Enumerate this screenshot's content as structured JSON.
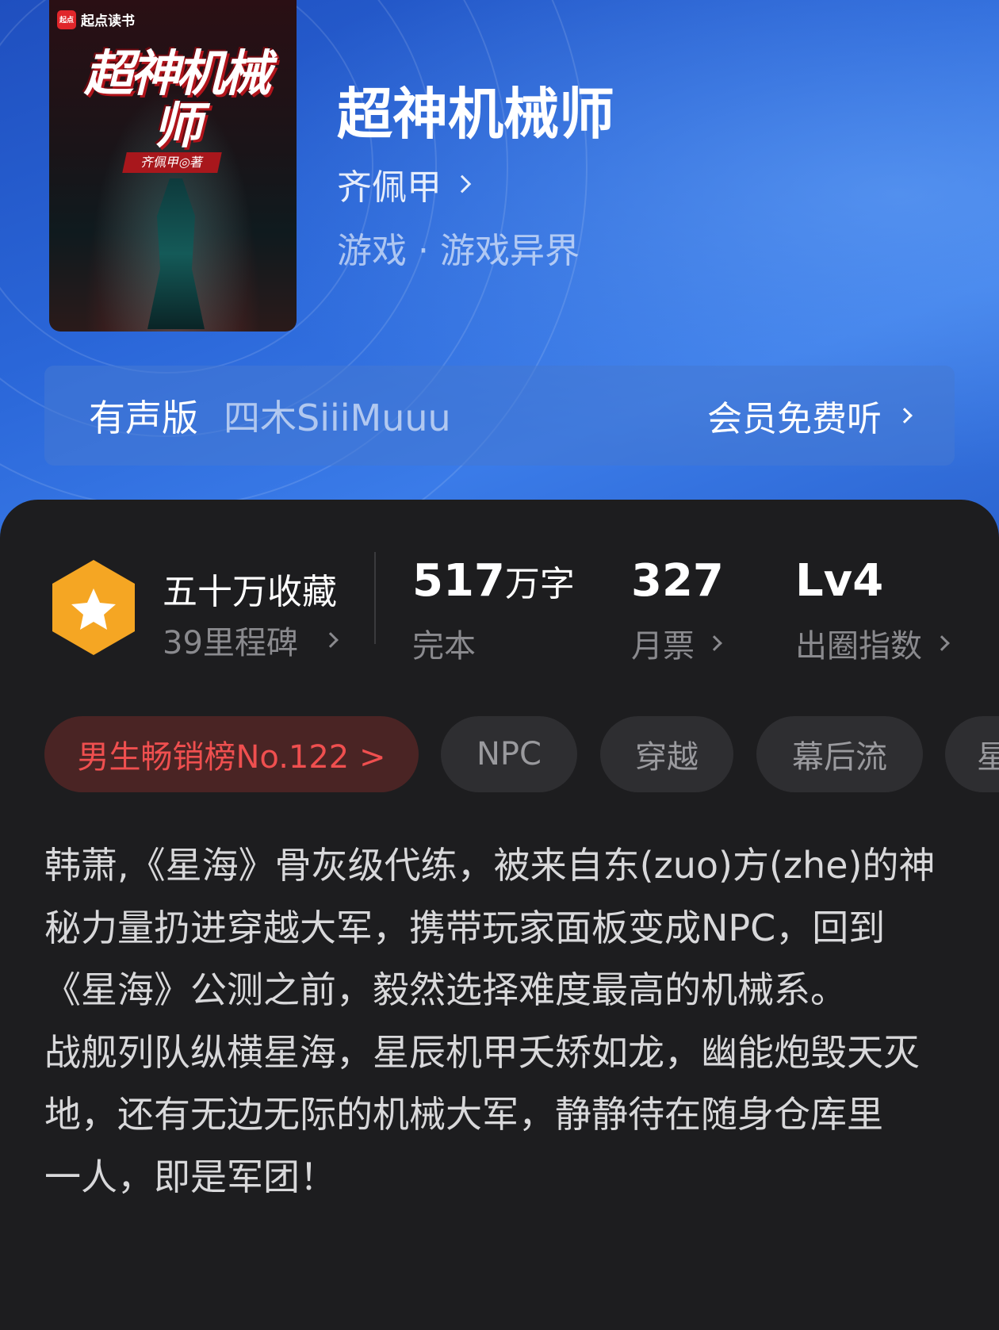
{
  "book": {
    "cover_brand": "起点读书",
    "cover_title": "超神机械师",
    "cover_author": "齐佩甲◎著",
    "title": "超神机械师",
    "author": "齐佩甲",
    "genre": "游戏 · 游戏异界"
  },
  "audio": {
    "label": "有声版",
    "narrator": "四木SiiiMuuu",
    "cta": "会员免费听"
  },
  "stats": {
    "collection": "五十万收藏",
    "milestones": "39里程碑",
    "words_num": "517",
    "words_unit": "万字",
    "status": "完本",
    "monthly_votes": "327",
    "monthly_label": "月票",
    "level": "Lv4",
    "level_label": "出圈指数"
  },
  "tags": [
    "男生畅销榜No.122 >",
    "NPC",
    "穿越",
    "幕后流",
    "星"
  ],
  "description": [
    "韩萧,《星海》骨灰级代练，被来自东(zuo)方(zhe)的神秘力量扔进穿越大军，携带玩家面板变成NPC，回到《星海》公测之前，毅然选择难度最高的机械系。",
    "战舰列队纵横星海，星辰机甲夭矫如龙，幽能炮毁天灭地，还有无边无际的机械大军，静静待在随身仓库里",
    "一人，即是军团！"
  ],
  "colors": {
    "hero_blue": "#2a66d8",
    "panel_bg": "#1d1d1f",
    "rank_red": "#ef4f4f",
    "badge_orange": "#f5a623"
  }
}
